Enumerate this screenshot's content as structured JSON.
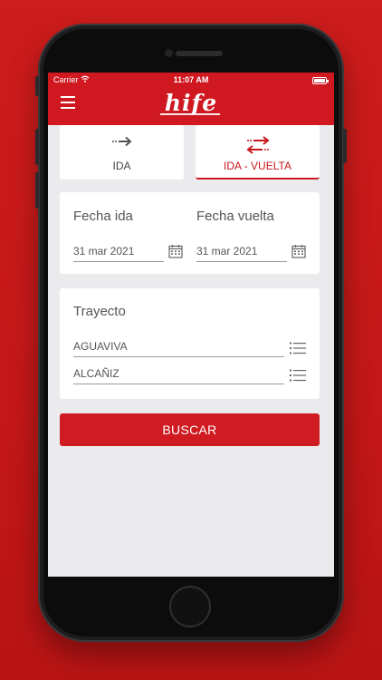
{
  "status_bar": {
    "carrier": "Carrier",
    "time": "11:07 AM"
  },
  "header": {
    "logo_text": "hife"
  },
  "tabs": [
    {
      "label": "IDA",
      "icon": "arrow-right-icon",
      "selected": false
    },
    {
      "label": "IDA - VUELTA",
      "icon": "arrows-round-trip-icon",
      "selected": true
    }
  ],
  "dates": {
    "departure_label": "Fecha ida",
    "departure_value": "31 mar 2021",
    "return_label": "Fecha vuelta",
    "return_value": "31 mar 2021"
  },
  "route": {
    "title": "Trayecto",
    "origin": "AGUAVIVA",
    "destination": "ALCAÑIZ"
  },
  "search_button": {
    "label": "BUSCAR"
  },
  "colors": {
    "brand_red": "#cf1820",
    "background_red": "#c81a1a",
    "screen_bg": "#ebebee"
  }
}
